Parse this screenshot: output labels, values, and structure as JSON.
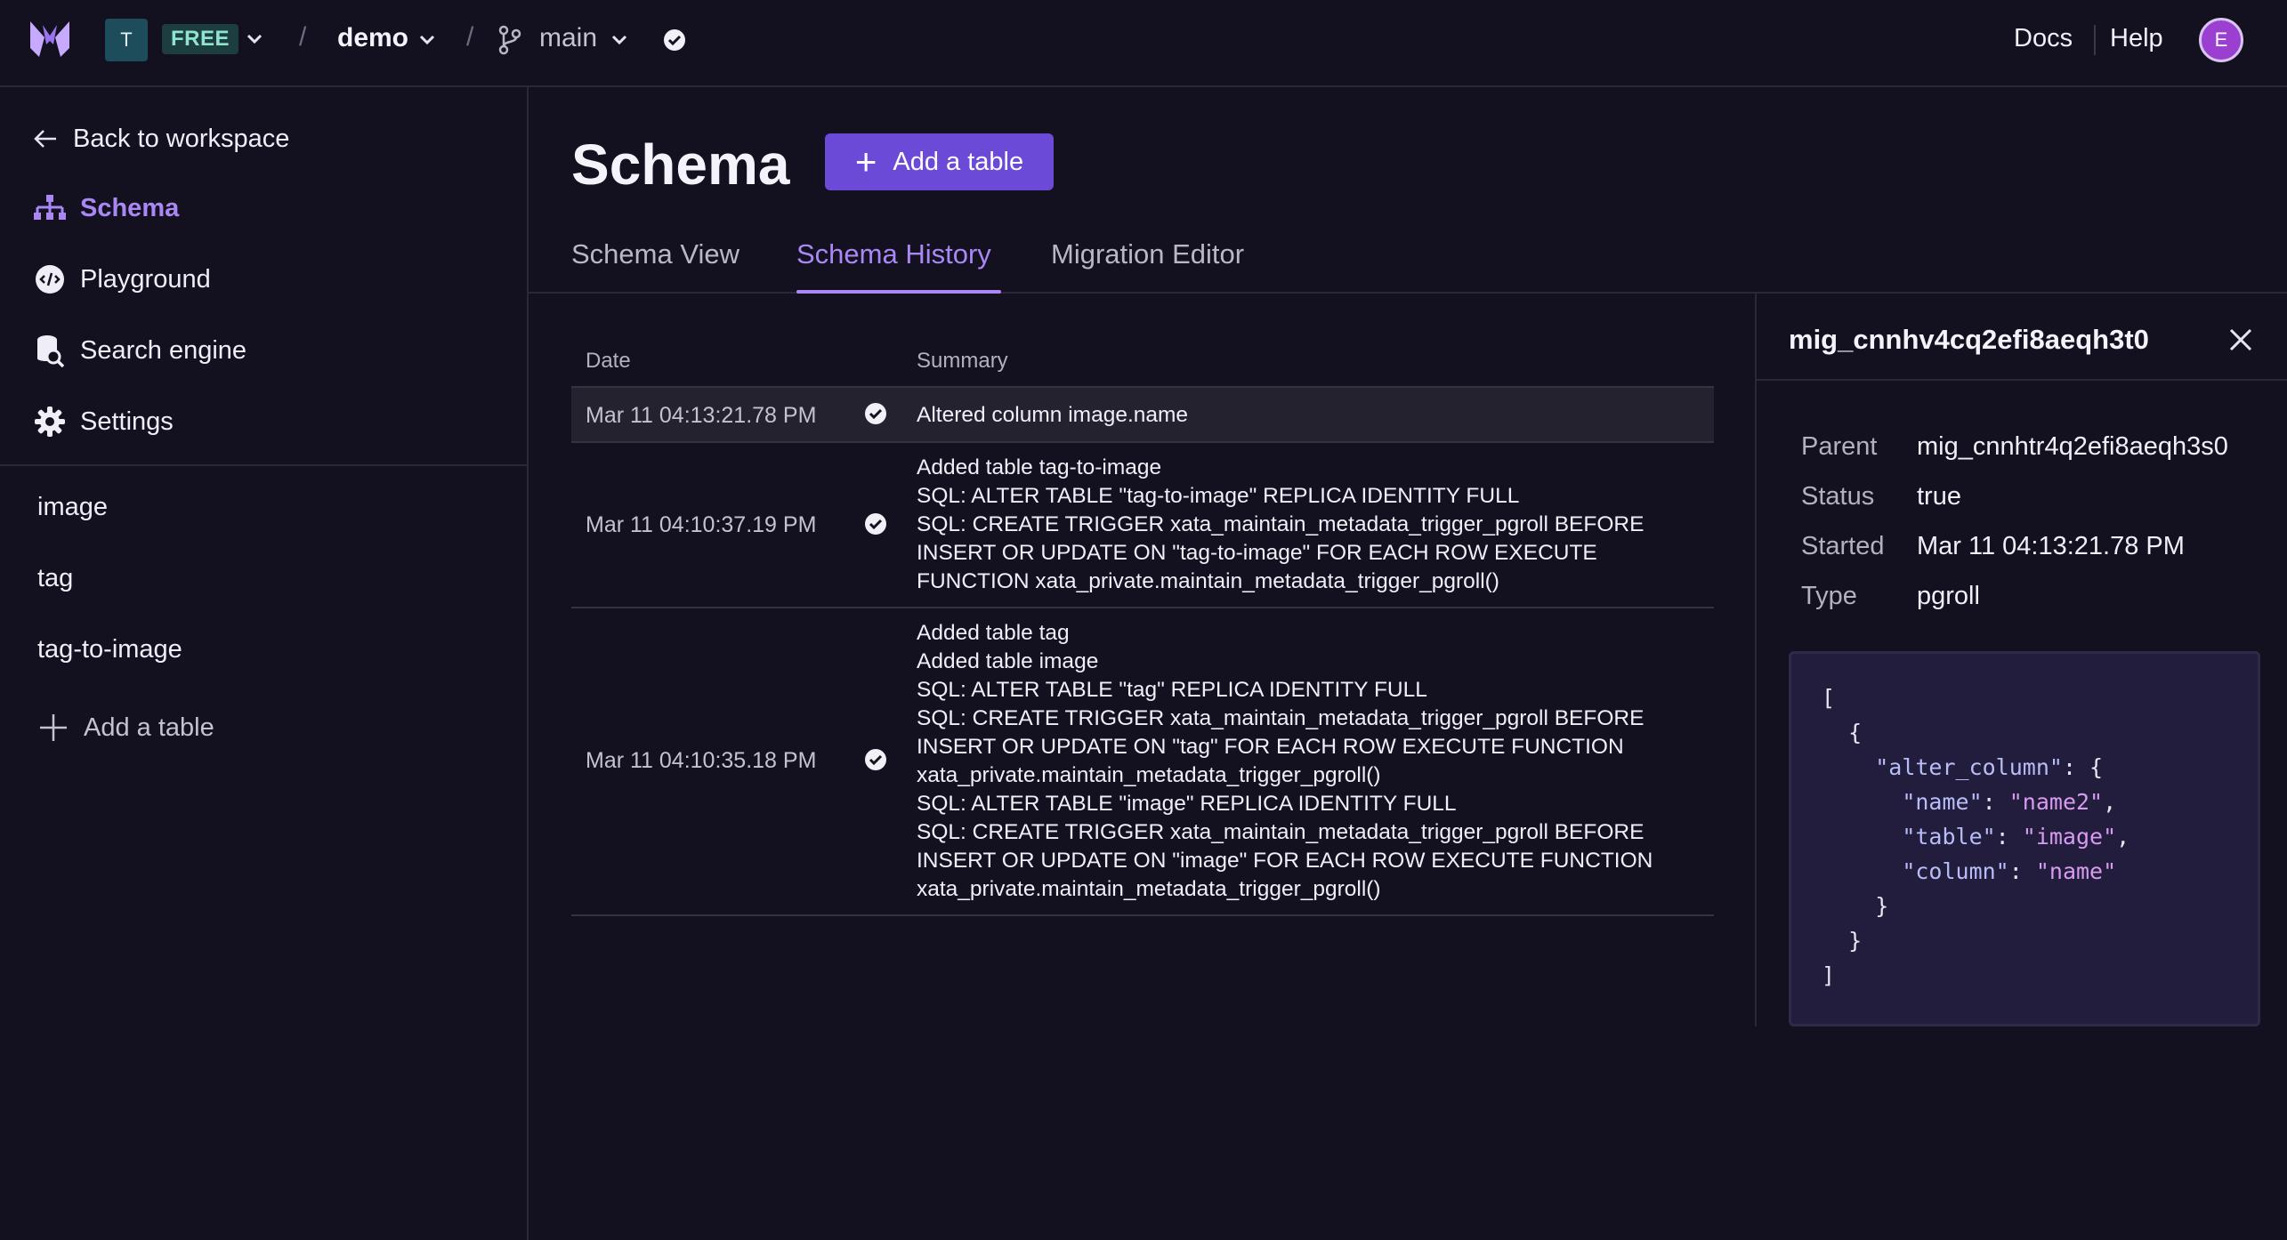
{
  "topbar": {
    "workspace_initial": "T",
    "plan_badge": "FREE",
    "database": "demo",
    "branch": "main",
    "links": {
      "docs": "Docs",
      "help": "Help"
    },
    "user_initial": "E"
  },
  "sidebar": {
    "back_label": "Back to workspace",
    "nav": [
      {
        "label": "Schema",
        "icon": "schema-icon",
        "active": true
      },
      {
        "label": "Playground",
        "icon": "playground-icon"
      },
      {
        "label": "Search engine",
        "icon": "search-engine-icon"
      },
      {
        "label": "Settings",
        "icon": "gear-icon"
      }
    ],
    "tables": [
      "image",
      "tag",
      "tag-to-image"
    ],
    "add_table_label": "Add a table"
  },
  "main": {
    "title": "Schema",
    "add_table_button": "Add a table",
    "tabs": [
      {
        "label": "Schema View"
      },
      {
        "label": "Schema History",
        "active": true
      },
      {
        "label": "Migration Editor"
      }
    ],
    "history": {
      "columns": {
        "date": "Date",
        "summary": "Summary"
      },
      "rows": [
        {
          "date": "Mar 11 04:13:21.78 PM",
          "lines": [
            "Altered column image.name"
          ]
        },
        {
          "date": "Mar 11 04:10:37.19 PM",
          "lines": [
            "Added table tag-to-image",
            "SQL: ALTER TABLE \"tag-to-image\" REPLICA IDENTITY FULL",
            "SQL: CREATE TRIGGER xata_maintain_metadata_trigger_pgroll BEFORE",
            "INSERT OR UPDATE ON \"tag-to-image\" FOR EACH ROW EXECUTE",
            "FUNCTION xata_private.maintain_metadata_trigger_pgroll()"
          ]
        },
        {
          "date": "Mar 11 04:10:35.18 PM",
          "lines": [
            "Added table tag",
            "Added table image",
            "SQL: ALTER TABLE \"tag\" REPLICA IDENTITY FULL",
            "SQL: CREATE TRIGGER xata_maintain_metadata_trigger_pgroll BEFORE",
            "INSERT OR UPDATE ON \"tag\" FOR EACH ROW EXECUTE FUNCTION",
            "xata_private.maintain_metadata_trigger_pgroll()",
            "SQL: ALTER TABLE \"image\" REPLICA IDENTITY FULL",
            "SQL: CREATE TRIGGER xata_maintain_metadata_trigger_pgroll BEFORE",
            "INSERT OR UPDATE ON \"image\" FOR EACH ROW EXECUTE FUNCTION",
            "xata_private.maintain_metadata_trigger_pgroll()"
          ]
        }
      ]
    }
  },
  "panel": {
    "title": "mig_cnnhv4cq2efi8aeqh3t0",
    "meta": [
      {
        "key": "Parent",
        "value": "mig_cnnhtr4q2efi8aeqh3s0"
      },
      {
        "key": "Status",
        "value": "true"
      },
      {
        "key": "Started",
        "value": "Mar 11 04:13:21.78 PM"
      },
      {
        "key": "Type",
        "value": "pgroll"
      }
    ],
    "code": {
      "open_bracket": "[",
      "open_brace": "{",
      "op_key": "\"alter_column\"",
      "fields": [
        {
          "key": "\"name\"",
          "value": "\"name2\""
        },
        {
          "key": "\"table\"",
          "value": "\"image\""
        },
        {
          "key": "\"column\"",
          "value": "\"name\""
        }
      ],
      "close_inner": "}",
      "close_brace": "}",
      "close_bracket": "]"
    }
  },
  "colors": {
    "background": "#13111f",
    "accent": "#a987f5",
    "button": "#6b4ad8",
    "code_bg": "#221c3d"
  }
}
